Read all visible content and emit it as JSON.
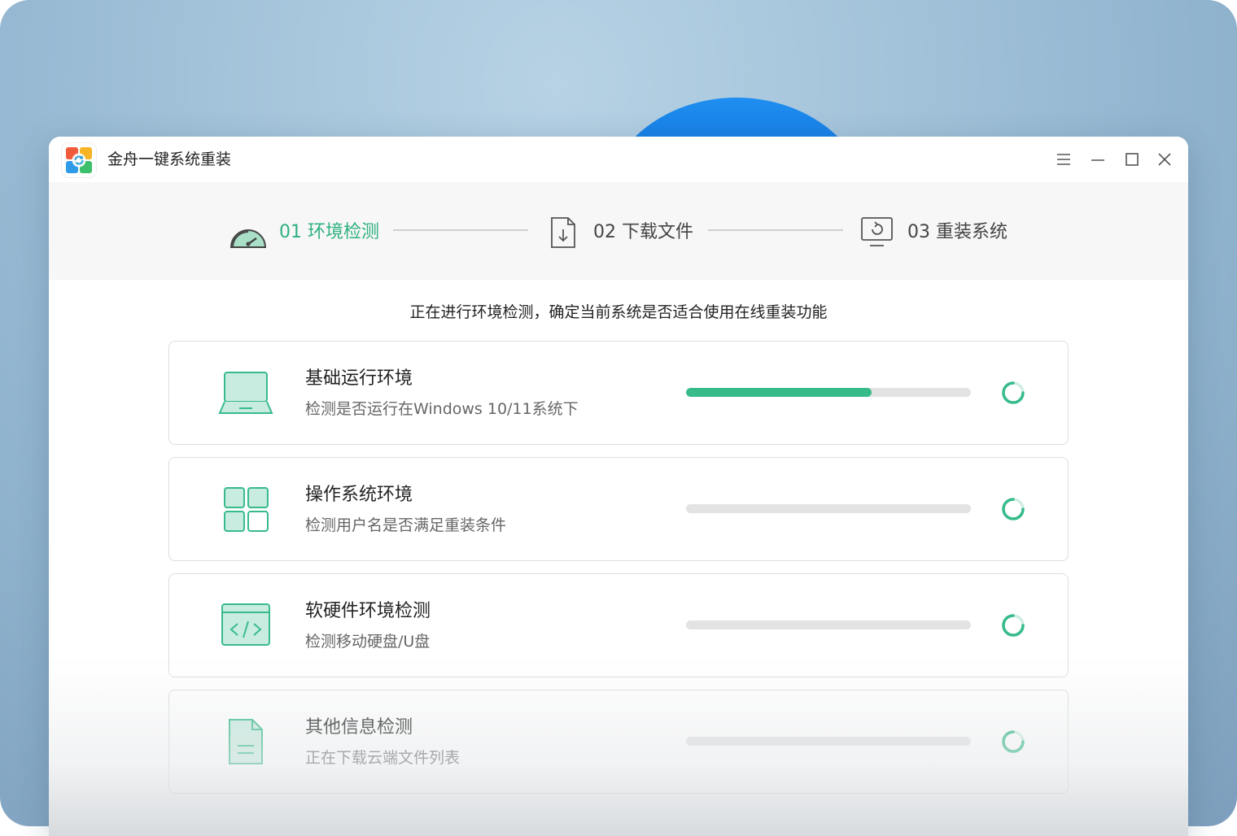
{
  "window": {
    "title": "金舟一键系统重装",
    "controls": [
      "menu-icon",
      "minimize-icon",
      "maximize-icon",
      "close-icon"
    ]
  },
  "steps": [
    {
      "label": "01 环境检测",
      "icon": "speedometer-icon",
      "active": true
    },
    {
      "label": "02 下载文件",
      "icon": "download-file-icon",
      "active": false
    },
    {
      "label": "03 重装系统",
      "icon": "reinstall-monitor-icon",
      "active": false
    }
  ],
  "notice": "正在进行环境检测，确定当前系统是否适合使用在线重装功能",
  "checks": [
    {
      "title": "基础运行环境",
      "desc": "检测是否运行在Windows 10/11系统下",
      "icon": "laptop-icon",
      "progress": 0.65
    },
    {
      "title": "操作系统环境",
      "desc": "检测用户名是否满足重装条件",
      "icon": "grid-apps-icon",
      "progress": 0
    },
    {
      "title": "软硬件环境检测",
      "desc": "检测移动硬盘/U盘",
      "icon": "code-window-icon",
      "progress": 0
    },
    {
      "title": "其他信息检测",
      "desc": "正在下载云端文件列表",
      "icon": "document-icon",
      "progress": 0
    }
  ],
  "colors": {
    "accent": "#37bb8b",
    "active_step_text": "#2fb07f",
    "inactive_step_text": "#444444",
    "track": "#e3e3e3"
  }
}
